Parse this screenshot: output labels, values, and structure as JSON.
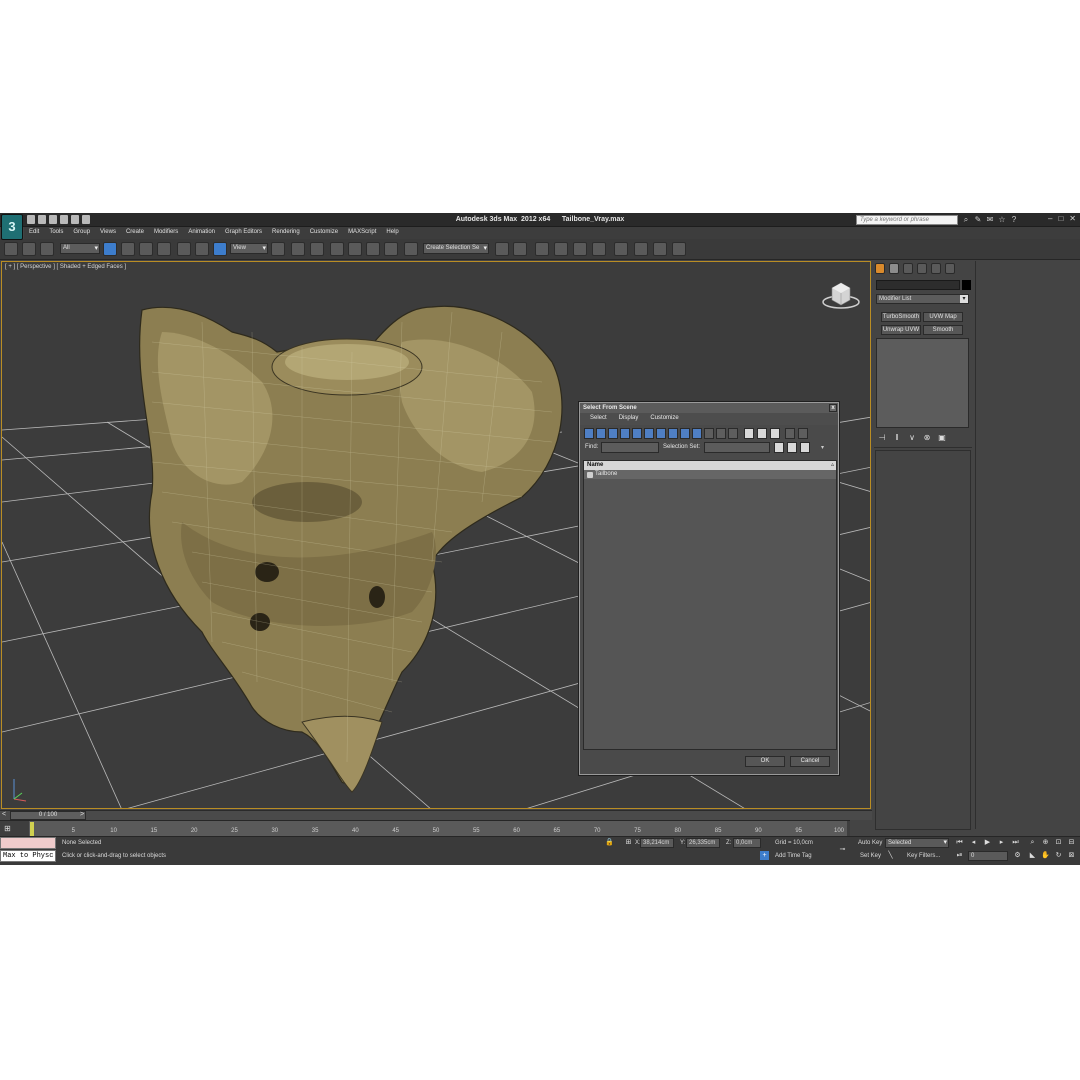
{
  "app": {
    "logo": "3",
    "title": "Autodesk 3ds Max  2012 x64      Tailbone_Vray.max",
    "search_placeholder": "Type a keyword or phrase"
  },
  "menu": [
    "Edit",
    "Tools",
    "Group",
    "Views",
    "Create",
    "Modifiers",
    "Animation",
    "Graph Editors",
    "Rendering",
    "Customize",
    "MAXScript",
    "Help"
  ],
  "toolbar": {
    "selection_filter": "All",
    "reference_coord": "View",
    "named_selection": "Create Selection Se"
  },
  "viewport": {
    "label": "[ + ] [ Perspective ] [ Shaded + Edged Faces ]"
  },
  "dialog": {
    "title": "Select From Scene",
    "close": "x",
    "menu": [
      "Select",
      "Display",
      "Customize"
    ],
    "find_label": "Find:",
    "selection_set_label": "Selection Set:",
    "column_header": "Name",
    "rows": [
      "Tailbone"
    ],
    "ok": "OK",
    "cancel": "Cancel"
  },
  "command_panel": {
    "modifier_list": "Modifier List",
    "modifiers": [
      "TurboSmooth",
      "UVW Map",
      "Unwrap UVW",
      "Smooth"
    ]
  },
  "timeline": {
    "frame": "0 / 100",
    "ticks": [
      "0",
      "5",
      "10",
      "15",
      "20",
      "25",
      "30",
      "35",
      "40",
      "45",
      "50",
      "55",
      "60",
      "65",
      "70",
      "75",
      "80",
      "85",
      "90",
      "95",
      "100"
    ]
  },
  "status": {
    "maxscript_text": "Max to Physc",
    "selection": "None Selected",
    "prompt": "Click or click-and-drag to select objects",
    "x_label": "X:",
    "x_value": "38,214cm",
    "y_label": "Y:",
    "y_value": "26,335cm",
    "z_label": "Z:",
    "z_value": "0,0cm",
    "grid": "Grid = 10,0cm",
    "add_time_tag": "Add Time Tag",
    "auto_key": "Auto Key",
    "set_key": "Set Key",
    "key_mode": "Selected",
    "key_filters": "Key Filters...",
    "current_frame": "0"
  }
}
